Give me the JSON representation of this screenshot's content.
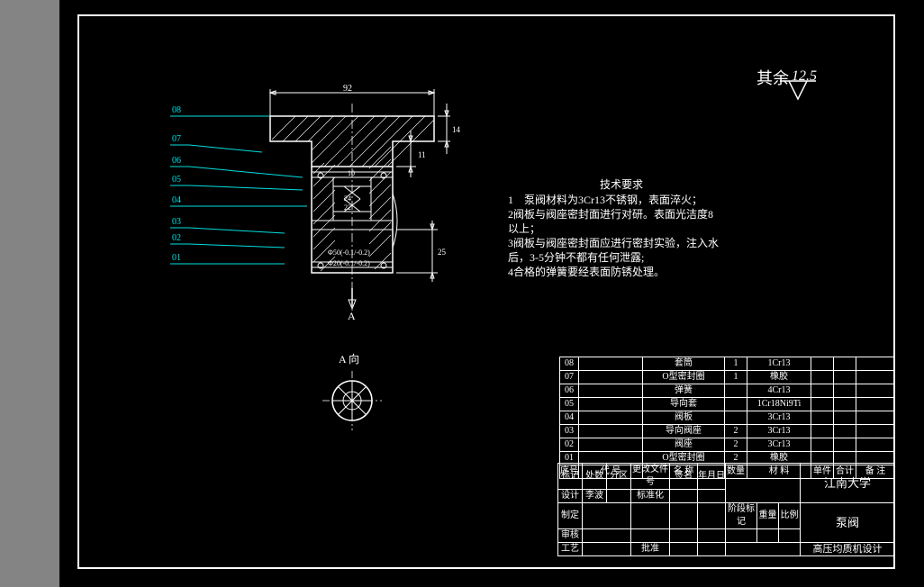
{
  "surface": {
    "label": "其余",
    "value": "12.5"
  },
  "part_callouts": [
    "08",
    "07",
    "06",
    "05",
    "04",
    "03",
    "02",
    "01"
  ],
  "dims": {
    "top_width": "92",
    "top_h1": "14",
    "top_h2": "11",
    "side_h": "25",
    "inner1": "10",
    "inner2": "24",
    "inner3": "22",
    "dia1": "Φ50(-0.1/-0.2)",
    "dia2": "Φ20(-0.1/-0.2)"
  },
  "section": {
    "arrow": "A",
    "label": "A 向"
  },
  "tech_req": {
    "title": "技术要求",
    "lines": [
      "1　泵阀材料为3Cr13不锈钢，表面淬火；",
      "2阀板与阀座密封面进行对研。表面光洁度8",
      "以上；",
      "3阀板与阀座密封面应进行密封实验，注入水",
      "后，3-5分钟不都有任何泄露;",
      "4合格的弹簧要经表面防锈处理。"
    ]
  },
  "bom_header": {
    "c1": "序号",
    "c2": "代 号",
    "c3": "名 称",
    "c4": "数量",
    "c5": "材 料",
    "c6": "单件",
    "c7": "合计",
    "c8": "备 注"
  },
  "bom": [
    {
      "no": "08",
      "code": "",
      "name": "套筒",
      "qty": "1",
      "mat": "1Cr13",
      "note": ""
    },
    {
      "no": "07",
      "code": "",
      "name": "O型密封圈",
      "qty": "1",
      "mat": "橡胶",
      "note": ""
    },
    {
      "no": "06",
      "code": "",
      "name": "弹簧",
      "qty": "",
      "mat": "4Cr13",
      "note": ""
    },
    {
      "no": "05",
      "code": "",
      "name": "导向套",
      "qty": "",
      "mat": "1Cr18Ni9Ti",
      "note": ""
    },
    {
      "no": "04",
      "code": "",
      "name": "阀板",
      "qty": "",
      "mat": "3Cr13",
      "note": ""
    },
    {
      "no": "03",
      "code": "",
      "name": "导向阀座",
      "qty": "2",
      "mat": "3Cr13",
      "note": ""
    },
    {
      "no": "02",
      "code": "",
      "name": "阀座",
      "qty": "2",
      "mat": "3Cr13",
      "note": ""
    },
    {
      "no": "01",
      "code": "",
      "name": "O型密封圈",
      "qty": "2",
      "mat": "橡胶",
      "note": ""
    }
  ],
  "titleblock": {
    "school": "江南大学",
    "part": "泵阀",
    "project": "高压均质机设计",
    "row1": {
      "c1": "标记",
      "c2": "处数",
      "c3": "分区",
      "c4": "更改文件号",
      "c5": "签名",
      "c6": "年月日"
    },
    "row2": {
      "c1": "设计",
      "c2": "李波",
      "c3": "",
      "c4": "标准化",
      "c5": "",
      "c6": ""
    },
    "row3": {
      "c1": "制定",
      "c2": "",
      "c3": "",
      "c4": "",
      "c5": "",
      "c6": ""
    },
    "row4": {
      "c1": "审核",
      "c2": "",
      "c3": "",
      "c4": "",
      "c5": "",
      "c6": ""
    },
    "row5": {
      "c1": "工艺",
      "c2": "",
      "c3": "",
      "c4": "批准",
      "c5": "",
      "c6": ""
    },
    "mid": {
      "c1": "阶段标记",
      "c2": "重量",
      "c3": "比例"
    }
  }
}
